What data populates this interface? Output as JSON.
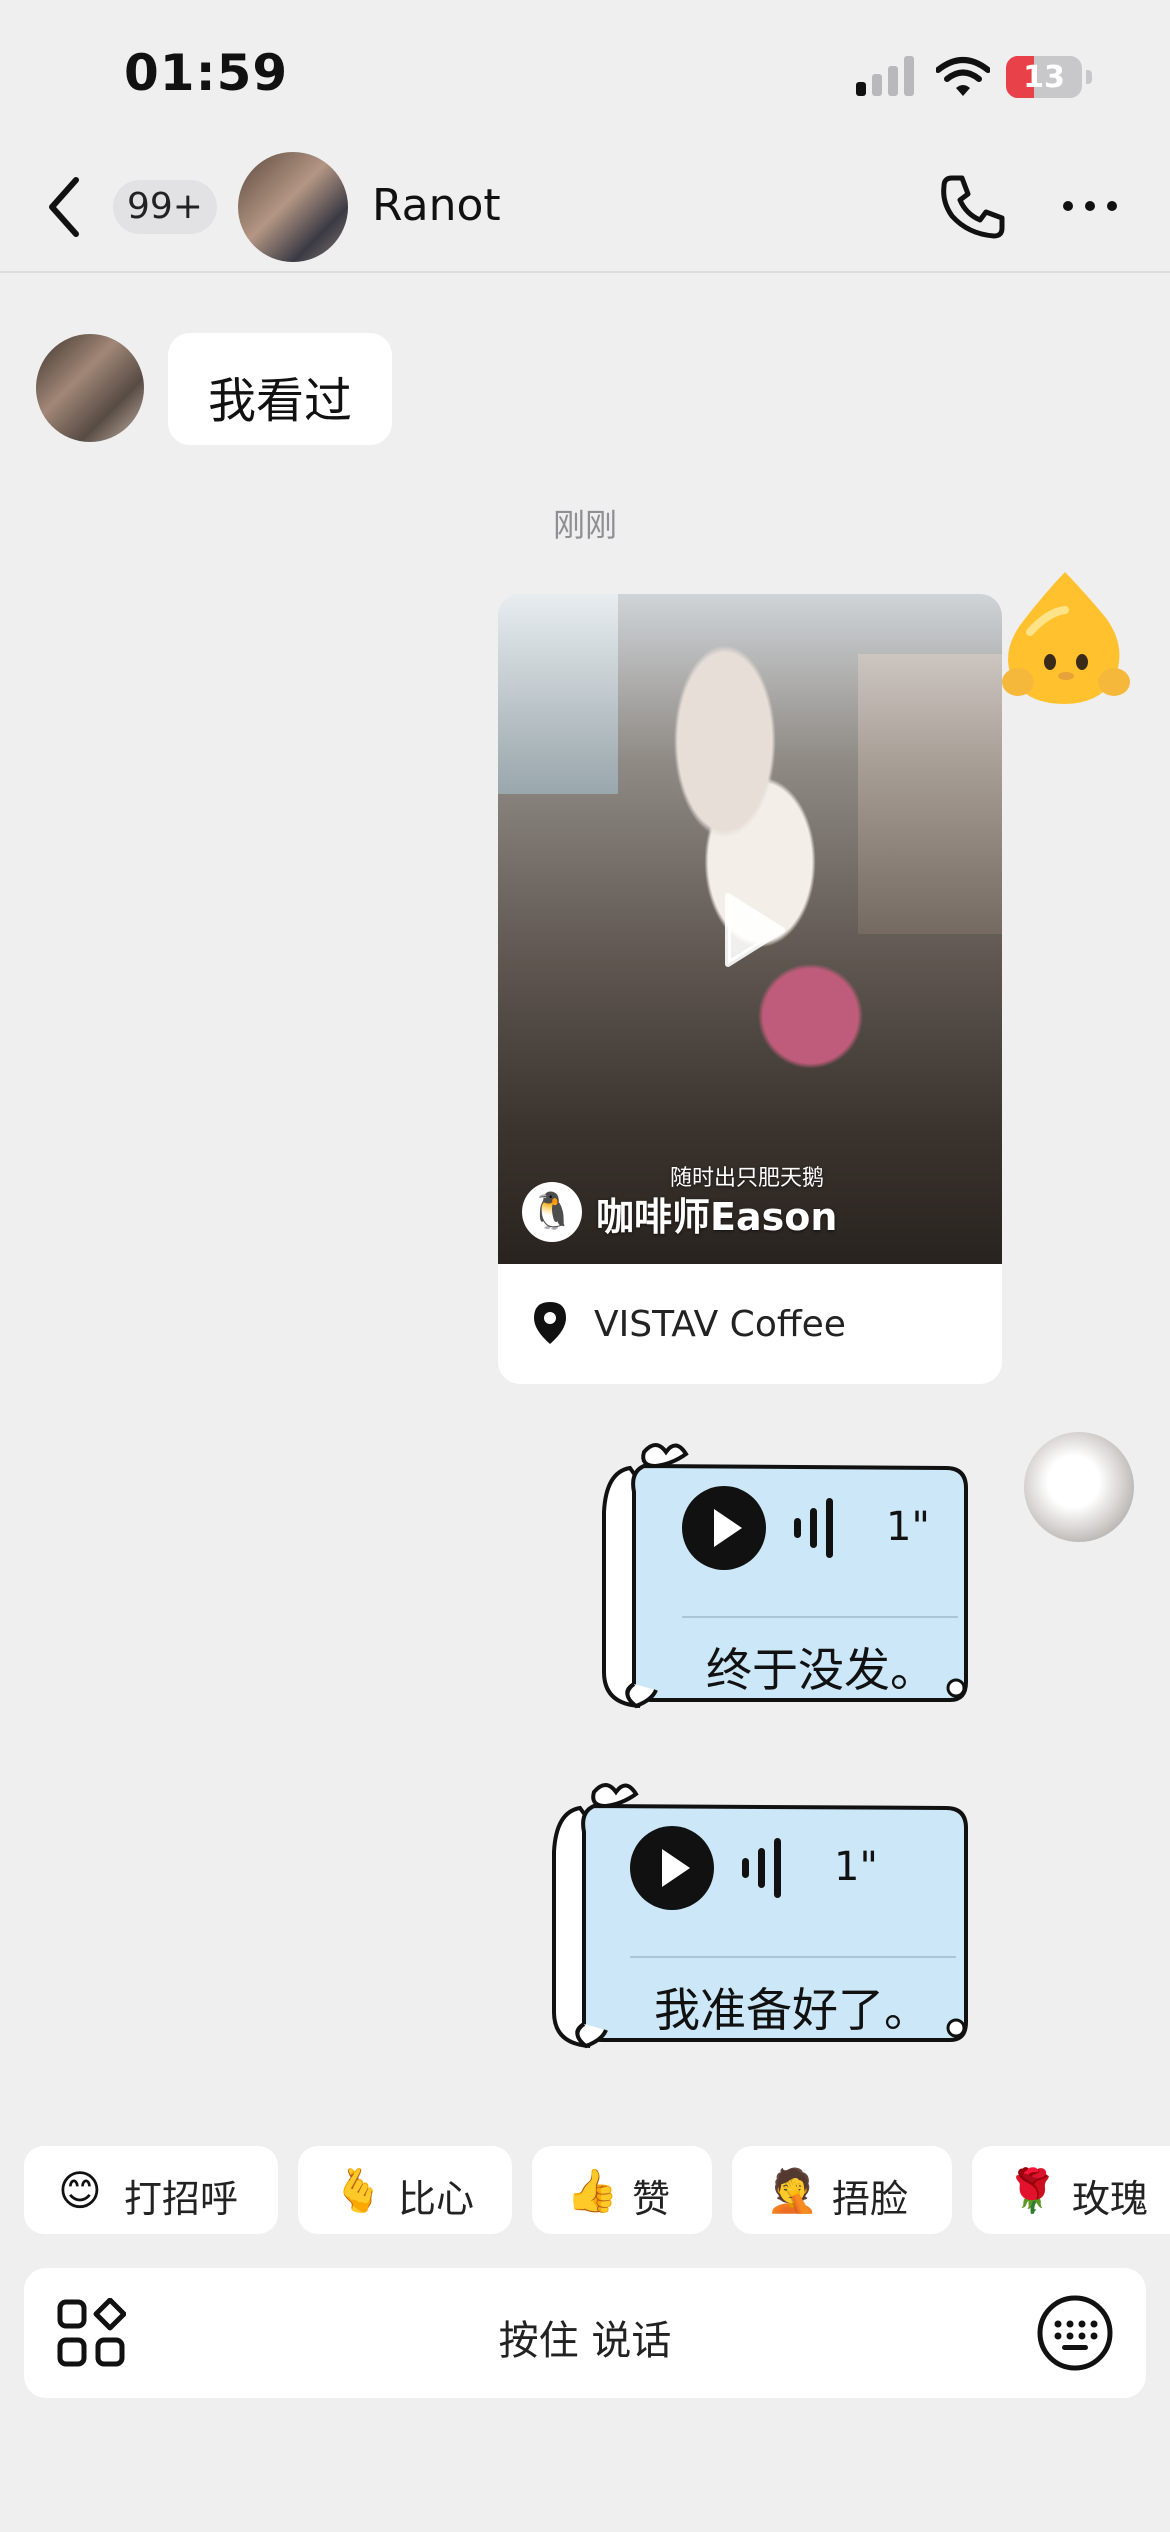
{
  "status_bar": {
    "time": "01:59",
    "battery_level": "13",
    "battery_color": "#e8414a"
  },
  "header": {
    "unread_count": "99+",
    "contact_name": "Ranot",
    "icons": [
      "back-icon",
      "phone-icon",
      "more-icon"
    ]
  },
  "messages": {
    "received_text": "我看过",
    "timestamp": "刚刚",
    "video_card": {
      "caption": "随时出只肥天鹅",
      "author": "咖啡师Eason",
      "author_avatar_glyph": "🐧",
      "location": "VISTAV Coffee"
    },
    "voice_1": {
      "duration": "1\"",
      "transcript": "终于没发。"
    },
    "voice_2": {
      "duration": "1\"",
      "transcript": "我准备好了。"
    }
  },
  "quick_replies": [
    {
      "emoji": "😊",
      "label": "打招呼"
    },
    {
      "emoji": "🫰",
      "label": "比心"
    },
    {
      "emoji": "👍",
      "label": "赞"
    },
    {
      "emoji": "🤦",
      "label": "捂脸"
    },
    {
      "emoji": "🌹",
      "label": "玫瑰"
    }
  ],
  "input_bar": {
    "hold_to_talk": "按住 说话"
  },
  "colors": {
    "background": "#efeff0",
    "voice_bubble": "#cce8f8",
    "chip_background": "#ffffff"
  }
}
